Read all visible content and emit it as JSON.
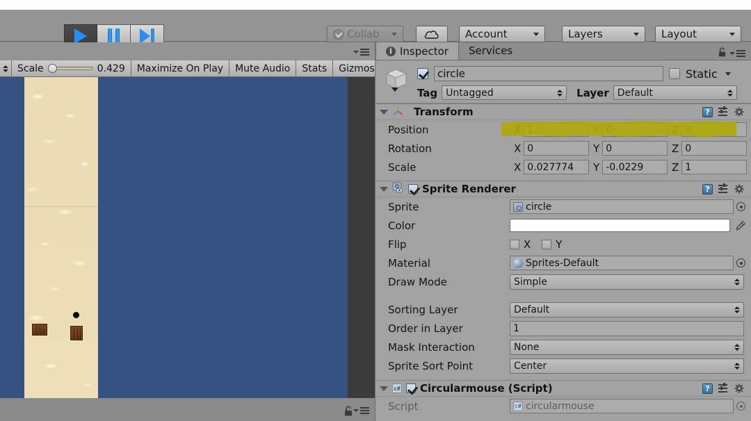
{
  "toolbar": {
    "play_icon": "play-icon",
    "pause_icon": "pause-icon",
    "step_icon": "step-icon",
    "collab_label": "Collab",
    "cloud_icon": "cloud-icon",
    "account_label": "Account",
    "layers_label": "Layers",
    "layout_label": "Layout"
  },
  "game_panel": {
    "scale_label": "Scale",
    "scale_value": "0.429",
    "maximize_label": "Maximize On Play",
    "mute_label": "Mute Audio",
    "stats_label": "Stats",
    "gizmos_label": "Gizmos",
    "panel_menu_icon": "panel-menu-icon",
    "lock_icon": "lock-icon",
    "scene": {
      "background_color": "#345180",
      "sand_color": "#ecdcb4",
      "crate_color": "#6b3e1d",
      "player_dot_color": "#000000"
    }
  },
  "inspector": {
    "tabs": [
      {
        "label": "Inspector",
        "icon": "info-icon",
        "active": true
      },
      {
        "label": "Services",
        "icon": "",
        "active": false
      }
    ],
    "lock_icon": "lock-icon",
    "menu_icon": "panel-menu-icon",
    "gameobject": {
      "icon": "cube-icon",
      "enabled": true,
      "name": "circle",
      "static_label": "Static",
      "static_checked": false,
      "tag_label": "Tag",
      "tag_value": "Untagged",
      "layer_label": "Layer",
      "layer_value": "Default"
    },
    "components": [
      {
        "title": "Transform",
        "icon": "transform-axis-icon",
        "has_checkbox": false,
        "rows": [
          {
            "label": "Position",
            "x": "1",
            "y": "0",
            "z": "0",
            "highlighted": true
          },
          {
            "label": "Rotation",
            "x": "0",
            "y": "0",
            "z": "0",
            "highlighted": false
          },
          {
            "label": "Scale",
            "x": "0.027774",
            "y": "-0.0229",
            "z": "1",
            "highlighted": false
          }
        ]
      },
      {
        "title": "Sprite Renderer",
        "icon": "sprite-renderer-icon",
        "has_checkbox": true,
        "enabled": true,
        "fields": {
          "sprite_label": "Sprite",
          "sprite_value": "circle",
          "color_label": "Color",
          "color_value": "#ffffff",
          "flip_label": "Flip",
          "flip_x_label": "X",
          "flip_y_label": "Y",
          "flip_x": false,
          "flip_y": false,
          "material_label": "Material",
          "material_value": "Sprites-Default",
          "draw_mode_label": "Draw Mode",
          "draw_mode_value": "Simple",
          "sorting_layer_label": "Sorting Layer",
          "sorting_layer_value": "Default",
          "order_label": "Order in Layer",
          "order_value": "1",
          "mask_label": "Mask Interaction",
          "mask_value": "None",
          "sort_point_label": "Sprite Sort Point",
          "sort_point_value": "Center"
        }
      },
      {
        "title": "Circularmouse (Script)",
        "icon": "csharp-script-icon",
        "has_checkbox": true,
        "enabled": true,
        "script_label": "Script",
        "script_value": "circularmouse"
      }
    ],
    "header_icons": {
      "help": "help-icon",
      "preset": "preset-icon",
      "settings": "gear-icon"
    },
    "annotation_color": "#aea80c"
  }
}
